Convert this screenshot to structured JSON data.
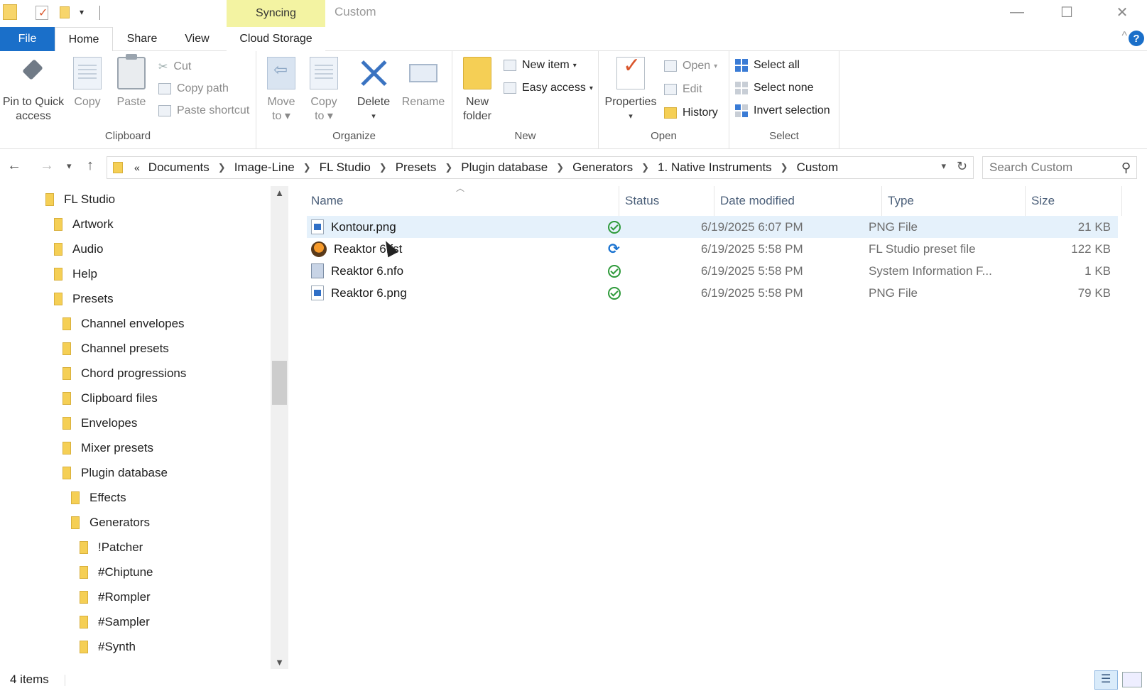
{
  "window": {
    "title": "Custom",
    "syncing_label": "Syncing",
    "minimize": "—",
    "maximize": "☐",
    "close": "✕"
  },
  "ribbon_tabs": {
    "file": "File",
    "home": "Home",
    "share": "Share",
    "view": "View",
    "cloud": "Cloud Storage",
    "collapse": "^",
    "help": "?"
  },
  "clipboard": {
    "pin_line1": "Pin to Quick",
    "pin_line2": "access",
    "copy": "Copy",
    "paste": "Paste",
    "cut": "Cut",
    "copy_path": "Copy path",
    "paste_shortcut": "Paste shortcut",
    "label": "Clipboard"
  },
  "organize": {
    "move_line1": "Move",
    "move_line2": "to ▾",
    "copyto_line1": "Copy",
    "copyto_line2": "to ▾",
    "delete": "Delete",
    "delete_arrow": "▾",
    "rename": "Rename",
    "label": "Organize"
  },
  "new_group": {
    "new_folder_line1": "New",
    "new_folder_line2": "folder",
    "new_item": "New item",
    "easy_access": "Easy access",
    "label": "New"
  },
  "open_group": {
    "properties": "Properties",
    "properties_arrow": "▾",
    "open": "Open",
    "edit": "Edit",
    "history": "History",
    "label": "Open"
  },
  "select_group": {
    "select_all": "Select all",
    "select_none": "Select none",
    "invert": "Invert selection",
    "label": "Select"
  },
  "address": {
    "overflow": "«",
    "crumbs": [
      "Documents",
      "Image-Line",
      "FL Studio",
      "Presets",
      "Plugin database",
      "Generators",
      "1. Native Instruments",
      "Custom"
    ],
    "search_placeholder": "Search Custom"
  },
  "tree": [
    {
      "label": "FL Studio",
      "level": 0
    },
    {
      "label": "Artwork",
      "level": 1
    },
    {
      "label": "Audio",
      "level": 1
    },
    {
      "label": "Help",
      "level": 1
    },
    {
      "label": "Presets",
      "level": 1
    },
    {
      "label": "Channel envelopes",
      "level": 2
    },
    {
      "label": "Channel presets",
      "level": 2
    },
    {
      "label": "Chord progressions",
      "level": 2
    },
    {
      "label": "Clipboard files",
      "level": 2
    },
    {
      "label": "Envelopes",
      "level": 2
    },
    {
      "label": "Mixer presets",
      "level": 2
    },
    {
      "label": "Plugin database",
      "level": 2
    },
    {
      "label": "Effects",
      "level": 3
    },
    {
      "label": "Generators",
      "level": 3
    },
    {
      "label": "!Patcher",
      "level": 4
    },
    {
      "label": "#Chiptune",
      "level": 4
    },
    {
      "label": "#Rompler",
      "level": 4
    },
    {
      "label": "#Sampler",
      "level": 4
    },
    {
      "label": "#Synth",
      "level": 4
    }
  ],
  "columns": {
    "name": "Name",
    "status": "Status",
    "date": "Date modified",
    "type": "Type",
    "size": "Size"
  },
  "files": [
    {
      "name": "Kontour.png",
      "status": "synced",
      "date": "6/19/2025 6:07 PM",
      "type": "PNG File",
      "size": "21 KB",
      "icon": "png-file-icon",
      "selected": true
    },
    {
      "name": "Reaktor 6.fst",
      "status": "syncing",
      "date": "6/19/2025 5:58 PM",
      "type": "FL Studio preset file",
      "size": "122 KB",
      "icon": "fl-studio-icon",
      "selected": false
    },
    {
      "name": "Reaktor 6.nfo",
      "status": "synced",
      "date": "6/19/2025 5:58 PM",
      "type": "System Information F...",
      "size": "1 KB",
      "icon": "nfo-file-icon",
      "selected": false
    },
    {
      "name": "Reaktor 6.png",
      "status": "synced",
      "date": "6/19/2025 5:58 PM",
      "type": "PNG File",
      "size": "79 KB",
      "icon": "png-file-icon",
      "selected": false
    }
  ],
  "statusbar": {
    "items_count": "4 items"
  }
}
